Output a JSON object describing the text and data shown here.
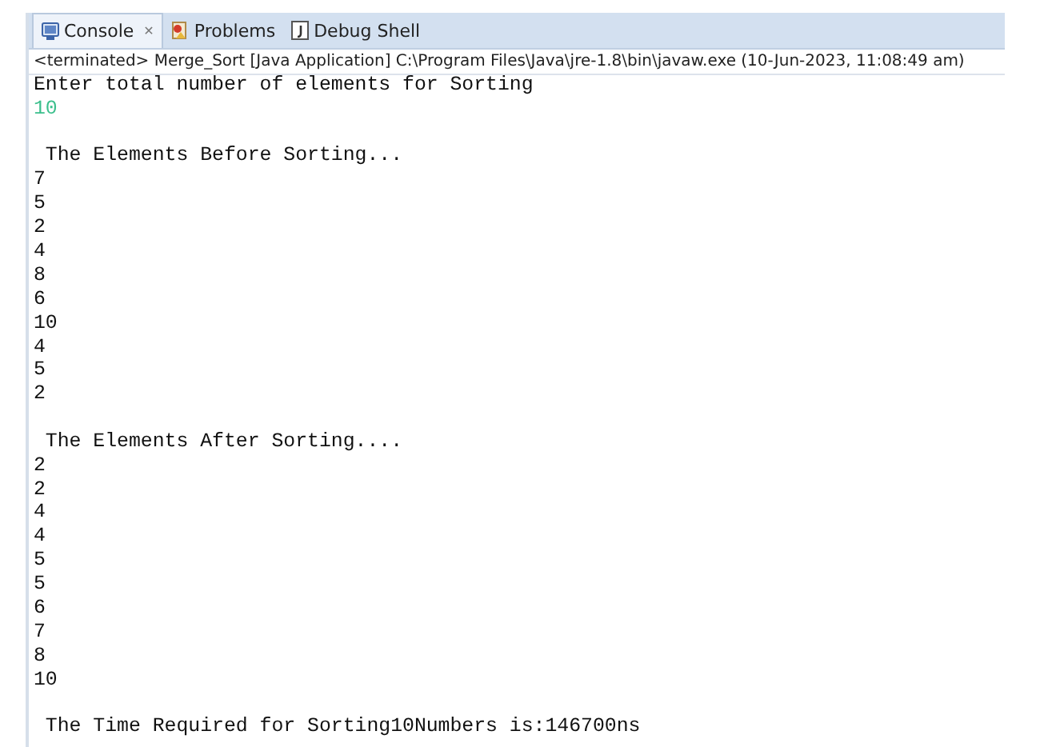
{
  "tabs": [
    {
      "label": "Console",
      "selected": true,
      "close": "✕"
    },
    {
      "label": "Problems",
      "selected": false
    },
    {
      "label": "Debug Shell",
      "selected": false
    }
  ],
  "status": "<terminated> Merge_Sort [Java Application] C:\\Program Files\\Java\\jre-1.8\\bin\\javaw.exe (10-Jun-2023, 11:08:49 am)",
  "lines": [
    {
      "text": "Enter total number of elements for Sorting",
      "kind": "output",
      "space_before": false
    },
    {
      "text": "10",
      "kind": "input",
      "space_before": false
    },
    {
      "text": " The Elements Before Sorting...",
      "kind": "output",
      "space_before": true
    },
    {
      "text": "7",
      "kind": "output",
      "space_before": false
    },
    {
      "text": "5",
      "kind": "output",
      "space_before": false
    },
    {
      "text": "2",
      "kind": "output",
      "space_before": false
    },
    {
      "text": "4",
      "kind": "output",
      "space_before": false
    },
    {
      "text": "8",
      "kind": "output",
      "space_before": false
    },
    {
      "text": "6",
      "kind": "output",
      "space_before": false
    },
    {
      "text": "10",
      "kind": "output",
      "space_before": false
    },
    {
      "text": "4",
      "kind": "output",
      "space_before": false
    },
    {
      "text": "5",
      "kind": "output",
      "space_before": false
    },
    {
      "text": "2",
      "kind": "output",
      "space_before": false
    },
    {
      "text": " The Elements After Sorting....",
      "kind": "output",
      "space_before": true
    },
    {
      "text": "2",
      "kind": "output",
      "space_before": false
    },
    {
      "text": "2",
      "kind": "output",
      "space_before": false
    },
    {
      "text": "4",
      "kind": "output",
      "space_before": false
    },
    {
      "text": "4",
      "kind": "output",
      "space_before": false
    },
    {
      "text": "5",
      "kind": "output",
      "space_before": false
    },
    {
      "text": "5",
      "kind": "output",
      "space_before": false
    },
    {
      "text": "6",
      "kind": "output",
      "space_before": false
    },
    {
      "text": "7",
      "kind": "output",
      "space_before": false
    },
    {
      "text": "8",
      "kind": "output",
      "space_before": false
    },
    {
      "text": "10",
      "kind": "output",
      "space_before": false
    },
    {
      "text": " The Time Required for Sorting10Numbers is:146700ns",
      "kind": "output",
      "space_before": true
    }
  ]
}
